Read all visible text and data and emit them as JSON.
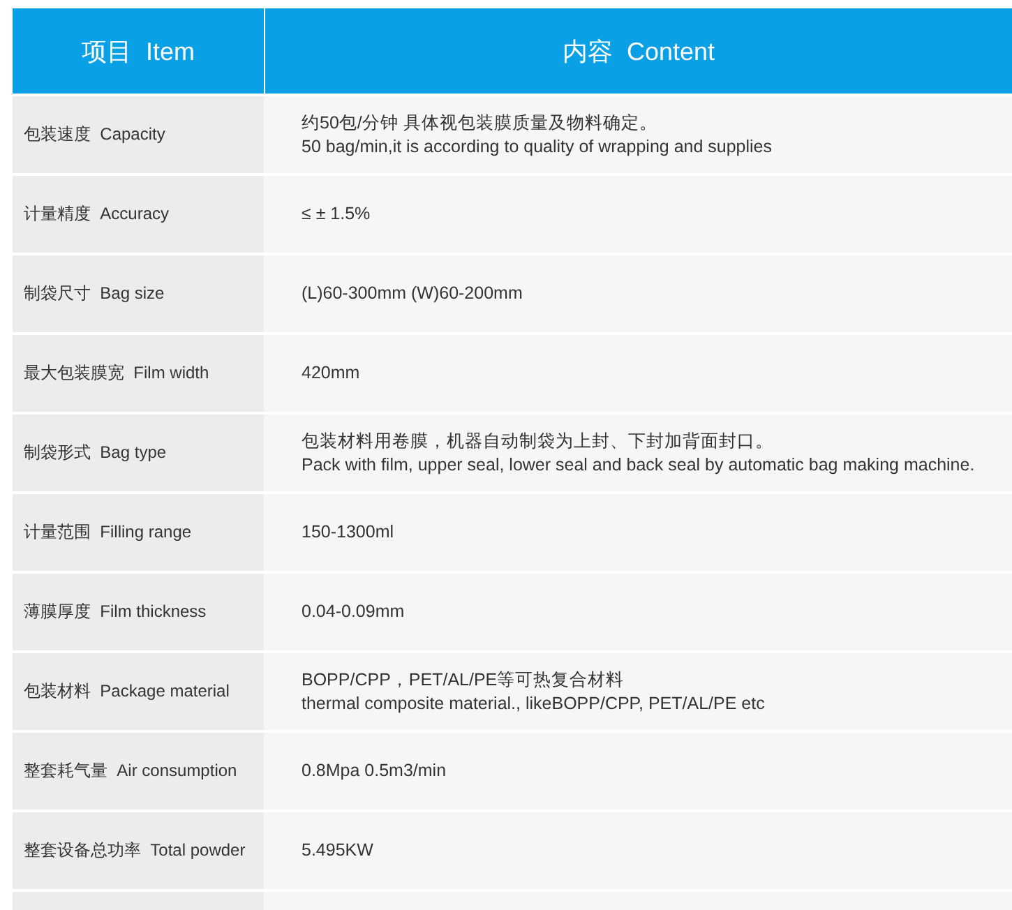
{
  "table": {
    "columns": [
      "项目  Item",
      "内容  Content"
    ],
    "rows": [
      {
        "item": "包装速度  Capacity",
        "content": [
          "约50包/分钟 具体视包装膜质量及物料确定。",
          "50 bag/min,it is according to quality of wrapping and supplies"
        ]
      },
      {
        "item": "计量精度  Accuracy",
        "content": [
          "≤ ± 1.5%"
        ]
      },
      {
        "item": "制袋尺寸  Bag size",
        "content": [
          "(L)60-300mm (W)60-200mm"
        ]
      },
      {
        "item": "最大包装膜宽  Film width",
        "content": [
          "420mm"
        ]
      },
      {
        "item": "制袋形式  Bag type",
        "content": [
          "包装材料用卷膜，机器自动制袋为上封、下封加背面封口。",
          "Pack with film, upper seal, lower seal and back seal by automatic bag making machine."
        ]
      },
      {
        "item": "计量范围  Filling range",
        "content": [
          "150-1300ml"
        ]
      },
      {
        "item": "薄膜厚度  Film thickness",
        "content": [
          "0.04-0.09mm"
        ]
      },
      {
        "item": "包装材料  Package material",
        "content": [
          "BOPP/CPP，PET/AL/PE等可热复合材料",
          "thermal composite material., likeBOPP/CPP, PET/AL/PE etc"
        ]
      },
      {
        "item": "整套耗气量  Air consumption",
        "content": [
          "0.8Mpa 0.5m3/min"
        ]
      },
      {
        "item": "整套设备总功率  Total powder",
        "content": [
          "5.495KW"
        ]
      }
    ]
  }
}
